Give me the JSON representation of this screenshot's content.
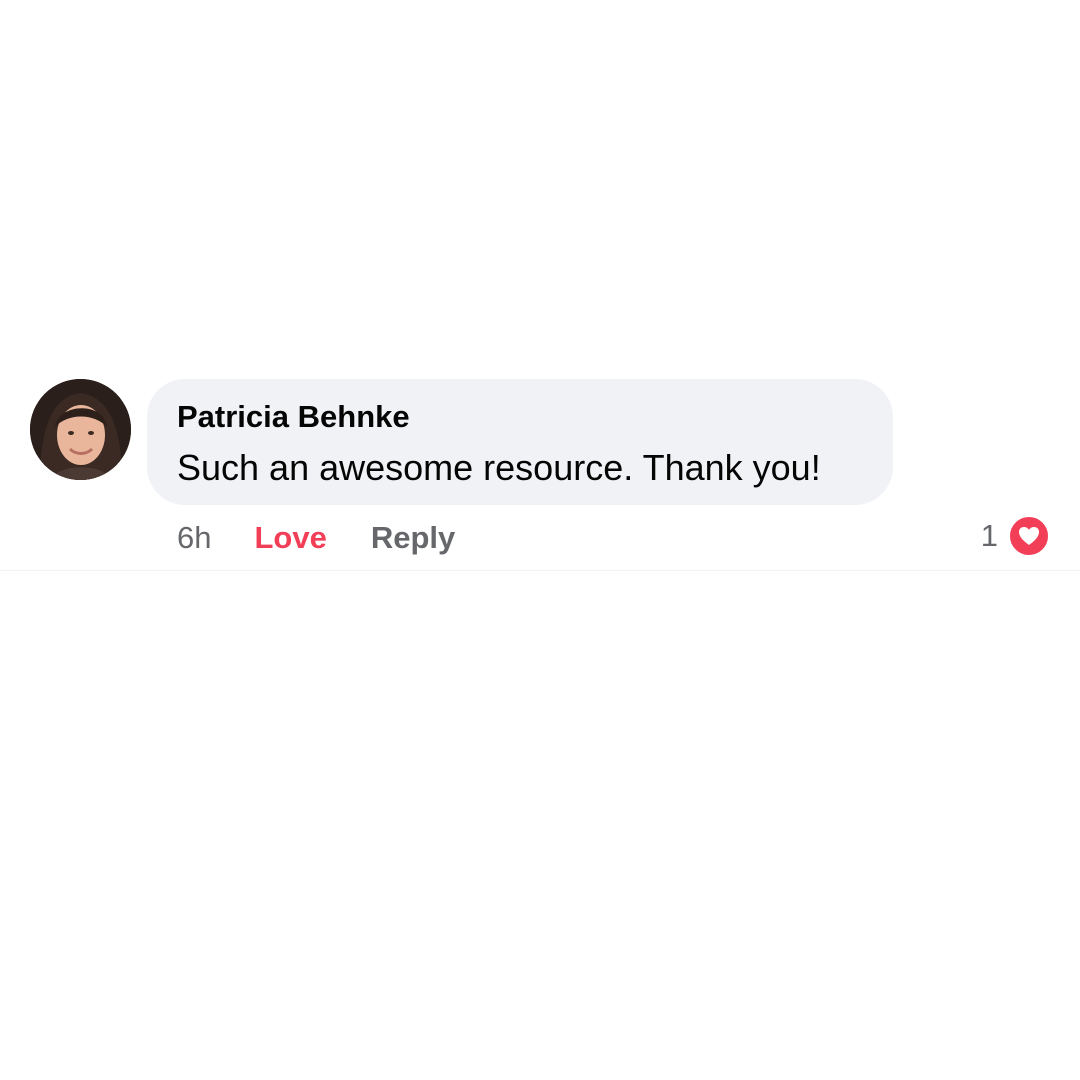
{
  "comment": {
    "author": "Patricia Behnke",
    "text": "Such an awesome resource. Thank you!",
    "time": "6h",
    "actions": {
      "love_label": "Love",
      "reply_label": "Reply"
    },
    "reactions": {
      "count": "1",
      "icon": "heart-icon"
    },
    "avatar_icon": "avatar"
  },
  "colors": {
    "bubble": "#f0f2f5",
    "love": "#f33e58",
    "meta": "#65676b",
    "text": "#050505"
  }
}
